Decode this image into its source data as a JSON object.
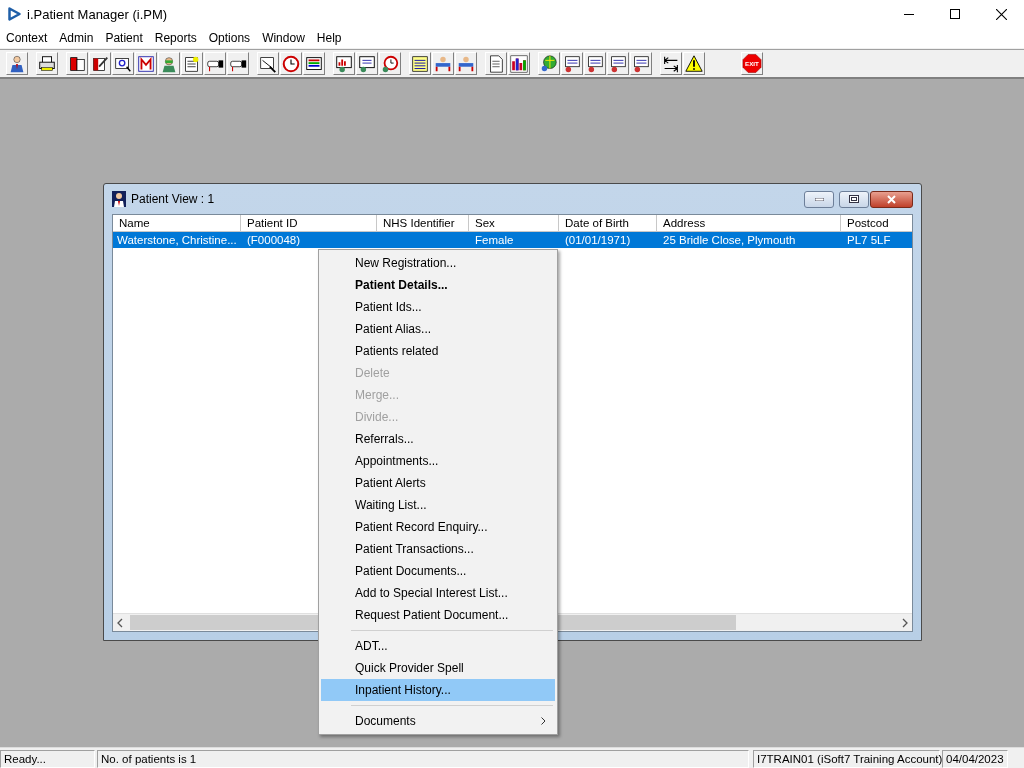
{
  "app": {
    "title": "i.Patient Manager (i.PM)"
  },
  "menu_bar": [
    "Context",
    "Admin",
    "Patient",
    "Reports",
    "Options",
    "Window",
    "Help"
  ],
  "toolbar": {
    "exit_label": "EXIT"
  },
  "patient_view": {
    "title": "Patient View : 1",
    "columns": [
      "Name",
      "Patient ID",
      "NHS Identifier",
      "Sex",
      "Date of Birth",
      "Address",
      "Postcod"
    ],
    "rows": [
      {
        "selected": true,
        "cells": [
          "Waterstone, Christine...",
          "(F000048)",
          null,
          "Female",
          "(01/01/1971)",
          "25 Bridle Close, Plymouth",
          "PL7 5LF"
        ]
      }
    ]
  },
  "context_menu": [
    {
      "kind": "item",
      "label": "New Registration...",
      "default": false,
      "disabled": false,
      "selected": false
    },
    {
      "kind": "item",
      "label": "Patient Details...",
      "default": true,
      "disabled": false,
      "selected": false
    },
    {
      "kind": "item",
      "label": "Patient Ids...",
      "default": false,
      "disabled": false,
      "selected": false
    },
    {
      "kind": "item",
      "label": "Patient Alias...",
      "default": false,
      "disabled": false,
      "selected": false
    },
    {
      "kind": "item",
      "label": "Patients related",
      "default": false,
      "disabled": false,
      "selected": false
    },
    {
      "kind": "item",
      "label": "Delete",
      "default": false,
      "disabled": true,
      "selected": false
    },
    {
      "kind": "item",
      "label": "Merge...",
      "default": false,
      "disabled": true,
      "selected": false
    },
    {
      "kind": "item",
      "label": "Divide...",
      "default": false,
      "disabled": true,
      "selected": false
    },
    {
      "kind": "item",
      "label": "Referrals...",
      "default": false,
      "disabled": false,
      "selected": false
    },
    {
      "kind": "item",
      "label": "Appointments...",
      "default": false,
      "disabled": false,
      "selected": false
    },
    {
      "kind": "item",
      "label": "Patient Alerts",
      "default": false,
      "disabled": false,
      "selected": false
    },
    {
      "kind": "item",
      "label": "Waiting List...",
      "default": false,
      "disabled": false,
      "selected": false
    },
    {
      "kind": "item",
      "label": "Patient Record Enquiry...",
      "default": false,
      "disabled": false,
      "selected": false
    },
    {
      "kind": "item",
      "label": "Patient Transactions...",
      "default": false,
      "disabled": false,
      "selected": false
    },
    {
      "kind": "item",
      "label": "Patient Documents...",
      "default": false,
      "disabled": false,
      "selected": false
    },
    {
      "kind": "item",
      "label": "Add to Special Interest List...",
      "default": false,
      "disabled": false,
      "selected": false
    },
    {
      "kind": "item",
      "label": "Request Patient Document...",
      "default": false,
      "disabled": false,
      "selected": false
    },
    {
      "kind": "separator"
    },
    {
      "kind": "item",
      "label": "ADT...",
      "default": false,
      "disabled": false,
      "selected": false
    },
    {
      "kind": "item",
      "label": "Quick Provider Spell",
      "default": false,
      "disabled": false,
      "selected": false
    },
    {
      "kind": "item",
      "label": "Inpatient History...",
      "default": false,
      "disabled": false,
      "selected": true
    },
    {
      "kind": "separator"
    },
    {
      "kind": "submenu",
      "label": "Documents",
      "default": false,
      "disabled": false,
      "selected": false
    }
  ],
  "status_bar": [
    "Ready...",
    "No. of patients is 1",
    "I7TRAIN01 (iSoft7 Training Account)",
    "04/04/2023"
  ]
}
